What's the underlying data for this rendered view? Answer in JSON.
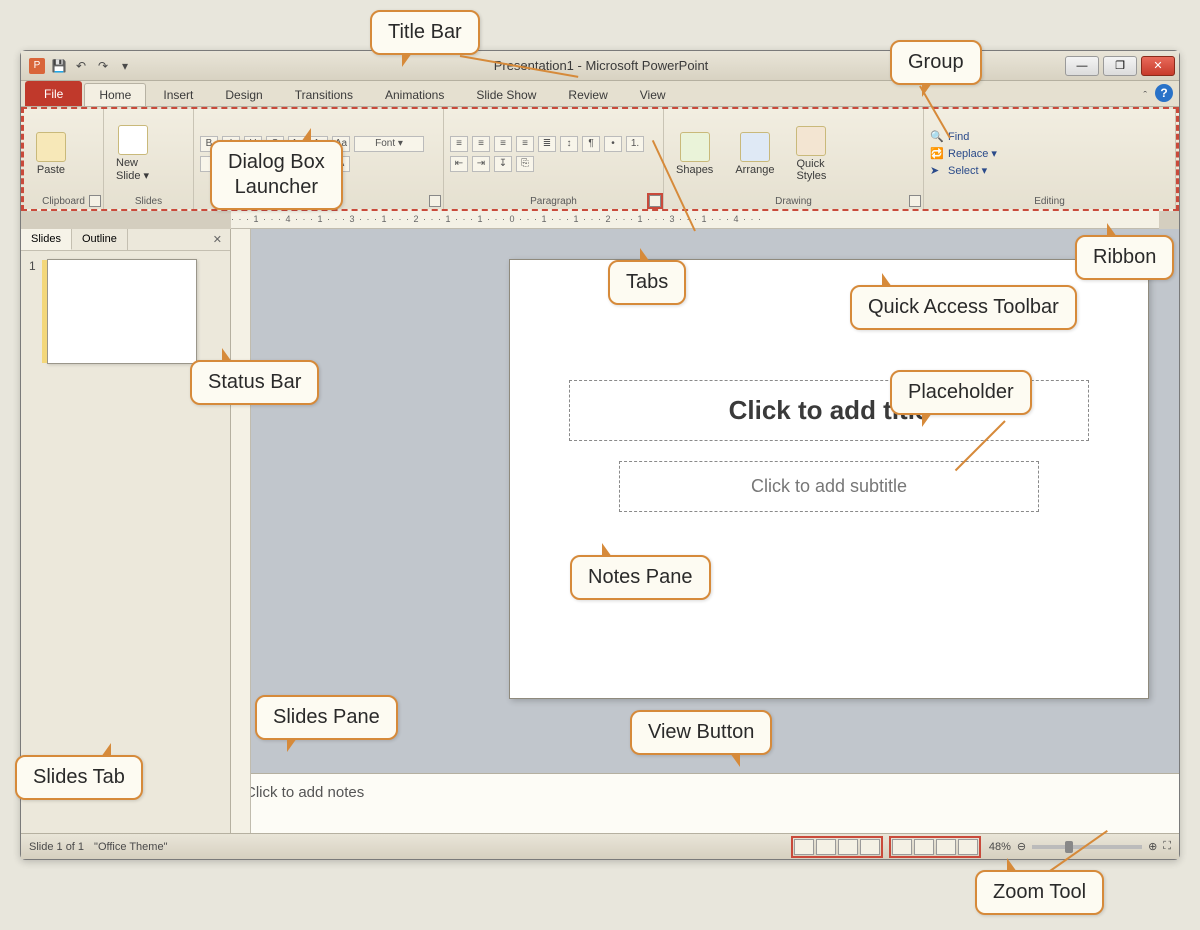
{
  "titleBar": {
    "appTitle": "Presentation1  -  Microsoft PowerPoint"
  },
  "tabs": {
    "file": "File",
    "items": [
      "Home",
      "Insert",
      "Design",
      "Transitions",
      "Animations",
      "Slide Show",
      "Review",
      "View"
    ]
  },
  "ribbon": {
    "clipboard": {
      "paste": "Paste",
      "label": "Clipboard"
    },
    "slides": {
      "newSlide": "New\nSlide ▾",
      "label": "Slides"
    },
    "font": {
      "label": "Font"
    },
    "paragraph": {
      "label": "Paragraph"
    },
    "drawing": {
      "shapes": "Shapes",
      "arrange": "Arrange",
      "quick": "Quick\nStyles",
      "label": "Drawing"
    },
    "editing": {
      "find": "Find",
      "replace": "Replace ▾",
      "select": "Select ▾",
      "label": "Editing"
    }
  },
  "panel": {
    "slidesTab": "Slides",
    "outlineTab": "Outline",
    "thumbNum": "1"
  },
  "slide": {
    "titlePH": "Click to add title",
    "subtitlePH": "Click to add subtitle"
  },
  "notes": {
    "placeholder": "Click to add notes"
  },
  "status": {
    "slideOf": "Slide 1 of 1",
    "theme": "\"Office Theme\"",
    "zoom": "48%"
  },
  "callouts": {
    "titleBar": "Title Bar",
    "group": "Group",
    "dialogLauncher": "Dialog Box\nLauncher",
    "tabs": "Tabs",
    "qat": "Quick Access Toolbar",
    "ribbon": "Ribbon",
    "statusBar": "Status Bar",
    "placeholder": "Placeholder",
    "notesPane": "Notes Pane",
    "slidesPane": "Slides Pane",
    "viewButton": "View Button",
    "slidesTab": "Slides Tab",
    "zoomTool": "Zoom Tool"
  },
  "ruler": "· · · 1 · · · 4 · · · 1 · · · 3 · · · 1 · · · 2 · · · 1 · · · 1 · · · 0 · · · 1 · · · 1 · · · 2 · · · 1 · · · 3 · · · 1 · · · 4 · · ·"
}
